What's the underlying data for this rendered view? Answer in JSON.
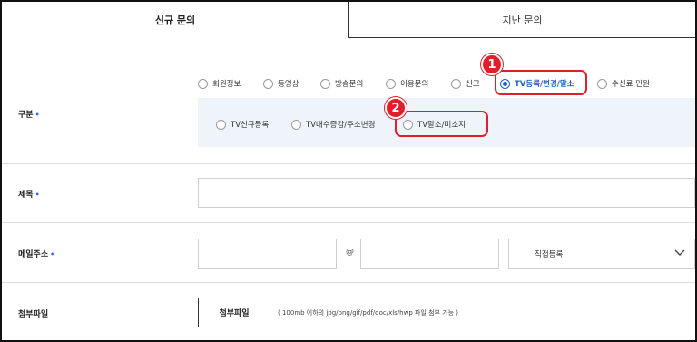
{
  "tabs": [
    {
      "label": "신규 문의"
    },
    {
      "label": "지난 문의"
    }
  ],
  "category": {
    "label": "구분",
    "required_mark": "•",
    "options": [
      {
        "label": "회원정보"
      },
      {
        "label": "동영상"
      },
      {
        "label": "방송문의"
      },
      {
        "label": "이용문의"
      },
      {
        "label": "신고"
      },
      {
        "label": "TV등록/변경/말소",
        "selected": true
      },
      {
        "label": "수신료 민원"
      }
    ],
    "sub_options": [
      {
        "label": "TV신규등록"
      },
      {
        "label": "TV대수증감/주소변경"
      },
      {
        "label": "TV말소/미소지"
      }
    ]
  },
  "annotations": [
    {
      "number": "1"
    },
    {
      "number": "2"
    }
  ],
  "title_field": {
    "label": "제목",
    "required_mark": "•",
    "value": ""
  },
  "email": {
    "label": "메일주소",
    "required_mark": "•",
    "local_value": "",
    "at_symbol": "@",
    "domain_value": "",
    "domain_select": "직접등록"
  },
  "attachment": {
    "label": "첨부파일",
    "button_label": "첨부파일",
    "hint": "( 100mb 이하의 jpg/png/gif/pdf/doc/xls/hwp 파일 첨부 가능 )"
  },
  "colors": {
    "accent": "#1f5fcf",
    "required": "#2b6fd6",
    "highlight": "#e31e2a",
    "subbox_bg": "#eef4fa"
  }
}
